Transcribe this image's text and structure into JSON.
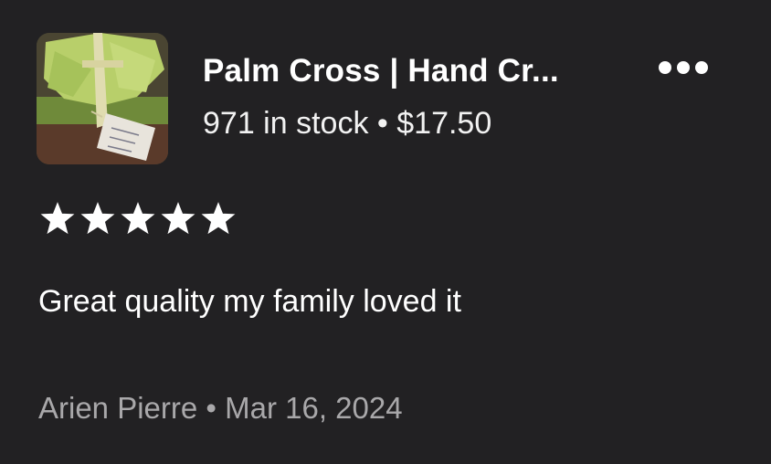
{
  "product": {
    "image_alt": "Palm cross product photo",
    "title": "Palm Cross | Hand Cr...",
    "stock": "971 in stock",
    "separator": " • ",
    "price": "$17.50"
  },
  "menu": {
    "icon": "more-horizontal-icon"
  },
  "rating": {
    "value": 5,
    "max": 5,
    "icon": "star-icon"
  },
  "review": {
    "text": "Great quality my family loved it",
    "author": "Arien Pierre",
    "separator": " • ",
    "date": "Mar 16, 2024"
  },
  "colors": {
    "background": "#222123",
    "text_primary": "#ffffff",
    "text_secondary": "#a9a8aa"
  }
}
